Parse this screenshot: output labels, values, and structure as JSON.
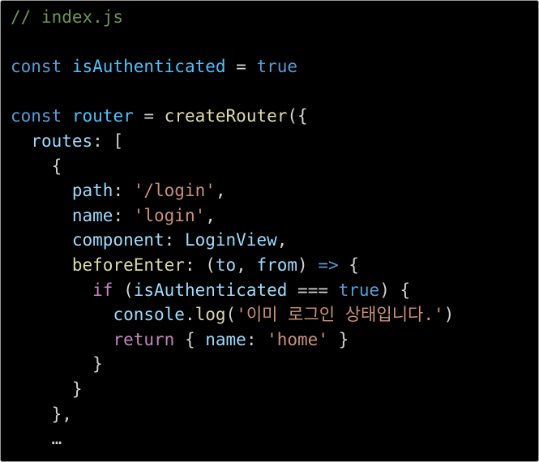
{
  "editor": {
    "colors": {
      "background": "#000000",
      "comment": "#6a9955",
      "keyword": "#569cd6",
      "constant": "#4fc1ff",
      "variable": "#9cdcfe",
      "function": "#dcdcaa",
      "string": "#ce9178",
      "class": "#4ec9b0",
      "control": "#c586c0",
      "punctuation": "#d4d4d4"
    },
    "lines": [
      [
        {
          "t": "// index.js",
          "c": "comment"
        }
      ],
      [],
      [
        {
          "t": "const",
          "c": "storage"
        },
        {
          "t": " "
        },
        {
          "t": "isAuthenticated",
          "c": "const"
        },
        {
          "t": " = "
        },
        {
          "t": "true",
          "c": "storage"
        }
      ],
      [],
      [
        {
          "t": "const",
          "c": "storage"
        },
        {
          "t": " "
        },
        {
          "t": "router",
          "c": "const"
        },
        {
          "t": " = "
        },
        {
          "t": "createRouter",
          "c": "fn"
        },
        {
          "t": "({"
        }
      ],
      [
        {
          "t": "  "
        },
        {
          "t": "routes",
          "c": "var"
        },
        {
          "t": ": ["
        }
      ],
      [
        {
          "t": "    {"
        }
      ],
      [
        {
          "t": "      "
        },
        {
          "t": "path",
          "c": "var"
        },
        {
          "t": ": "
        },
        {
          "t": "'/login'",
          "c": "str"
        },
        {
          "t": ","
        }
      ],
      [
        {
          "t": "      "
        },
        {
          "t": "name",
          "c": "var"
        },
        {
          "t": ": "
        },
        {
          "t": "'login'",
          "c": "str"
        },
        {
          "t": ","
        }
      ],
      [
        {
          "t": "      "
        },
        {
          "t": "component",
          "c": "var"
        },
        {
          "t": ": "
        },
        {
          "t": "LoginView",
          "c": "var"
        },
        {
          "t": ","
        }
      ],
      [
        {
          "t": "      "
        },
        {
          "t": "beforeEnter",
          "c": "fn"
        },
        {
          "t": ": ("
        },
        {
          "t": "to",
          "c": "var"
        },
        {
          "t": ", "
        },
        {
          "t": "from",
          "c": "var"
        },
        {
          "t": ") "
        },
        {
          "t": "=>",
          "c": "storage"
        },
        {
          "t": " {"
        }
      ],
      [
        {
          "t": "        "
        },
        {
          "t": "if",
          "c": "ctrl"
        },
        {
          "t": " ("
        },
        {
          "t": "isAuthenticated",
          "c": "var"
        },
        {
          "t": " === "
        },
        {
          "t": "true",
          "c": "storage"
        },
        {
          "t": ") {"
        }
      ],
      [
        {
          "t": "          "
        },
        {
          "t": "console",
          "c": "var"
        },
        {
          "t": "."
        },
        {
          "t": "log",
          "c": "fn"
        },
        {
          "t": "("
        },
        {
          "t": "'이미 로그인 상태입니다.'",
          "c": "str"
        },
        {
          "t": ")"
        }
      ],
      [
        {
          "t": "          "
        },
        {
          "t": "return",
          "c": "ctrl"
        },
        {
          "t": " { "
        },
        {
          "t": "name",
          "c": "var"
        },
        {
          "t": ": "
        },
        {
          "t": "'home'",
          "c": "str"
        },
        {
          "t": " }"
        }
      ],
      [
        {
          "t": "        }"
        }
      ],
      [
        {
          "t": "      }"
        }
      ],
      [
        {
          "t": "    },"
        }
      ],
      [
        {
          "t": "    …"
        }
      ]
    ]
  }
}
